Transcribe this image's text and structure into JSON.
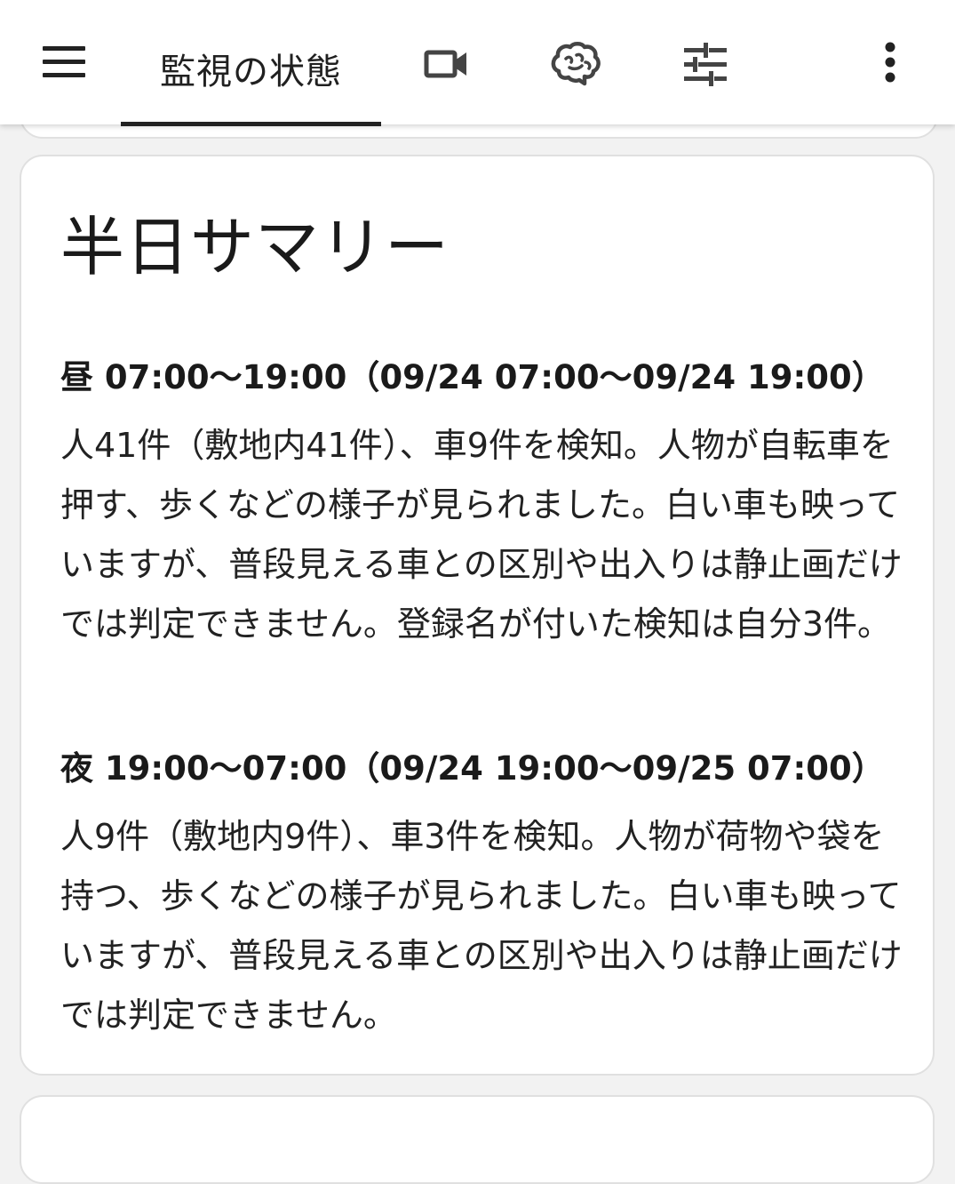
{
  "header": {
    "menu_icon": "hamburger-menu-icon",
    "tabs": [
      {
        "label": "監視の状態",
        "active": true
      },
      {
        "icon": "video-camera-icon"
      },
      {
        "icon": "ai-brain-icon"
      },
      {
        "icon": "tune-sliders-icon"
      }
    ],
    "more_icon": "more-vertical-icon"
  },
  "summary": {
    "title": "半日サマリー",
    "day": {
      "heading": "昼 07:00〜19:00（09/24 07:00〜09/24 19:00）",
      "text": "人41件（敷地内41件）、車9件を検知。人物が自転車を押す、歩くなどの様子が見られました。白い車も映っていますが、普段見える車との区別や出入りは静止画だけでは判定できません。登録名が付いた検知は自分3件。"
    },
    "night": {
      "heading": "夜 19:00〜07:00（09/24 19:00〜09/25 07:00）",
      "text": "人9件（敷地内9件）、車3件を検知。人物が荷物や袋を持つ、歩くなどの様子が見られました。白い車も映っていますが、普段見える車との区別や出入りは静止画だけでは判定できません。"
    }
  },
  "colors": {
    "appbar_bg": "#ffffff",
    "page_bg": "#f2f2f2",
    "text": "#1f1f1f",
    "tab_indicator": "#222222"
  }
}
